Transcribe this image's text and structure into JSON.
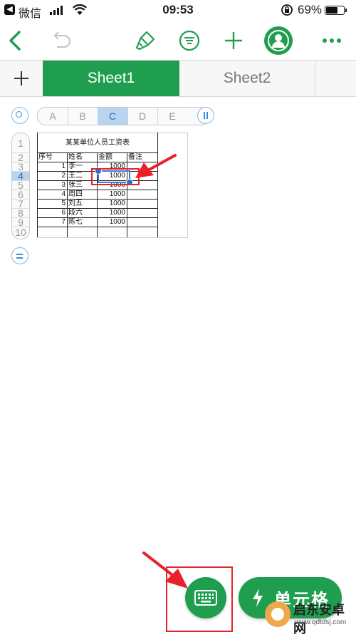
{
  "status_bar": {
    "app_back_label": "微信",
    "time": "09:53",
    "battery": "69%"
  },
  "tabs": [
    {
      "label": "Sheet1",
      "active": true
    },
    {
      "label": "Sheet2",
      "active": false
    }
  ],
  "columns": [
    "A",
    "B",
    "C",
    "D",
    "E"
  ],
  "rows": [
    "1",
    "2",
    "3",
    "4",
    "5",
    "6",
    "7",
    "8",
    "9",
    "10"
  ],
  "selected_column": "C",
  "selected_row": "4",
  "sheet": {
    "title": "某某单位人员工资表",
    "headers": [
      "序号",
      "姓名",
      "金额",
      "备注"
    ],
    "records": [
      {
        "no": "1",
        "name": "李一",
        "amount": "1000"
      },
      {
        "no": "2",
        "name": "王二",
        "amount": "1000"
      },
      {
        "no": "3",
        "name": "张三",
        "amount": "1000"
      },
      {
        "no": "4",
        "name": "周四",
        "amount": "1000"
      },
      {
        "no": "5",
        "name": "刘五",
        "amount": "1000"
      },
      {
        "no": "6",
        "name": "段六",
        "amount": "1000"
      },
      {
        "no": "7",
        "name": "陈七",
        "amount": "1000"
      }
    ]
  },
  "bottom": {
    "cell_button_label": "单元格"
  },
  "watermark": {
    "title": "启东安卓网",
    "url": "www.qdtdsj.com"
  },
  "colors": {
    "accent_green": "#1f9e4f",
    "selection_blue": "#3a7fd4",
    "annotation_red": "#e8212a"
  }
}
